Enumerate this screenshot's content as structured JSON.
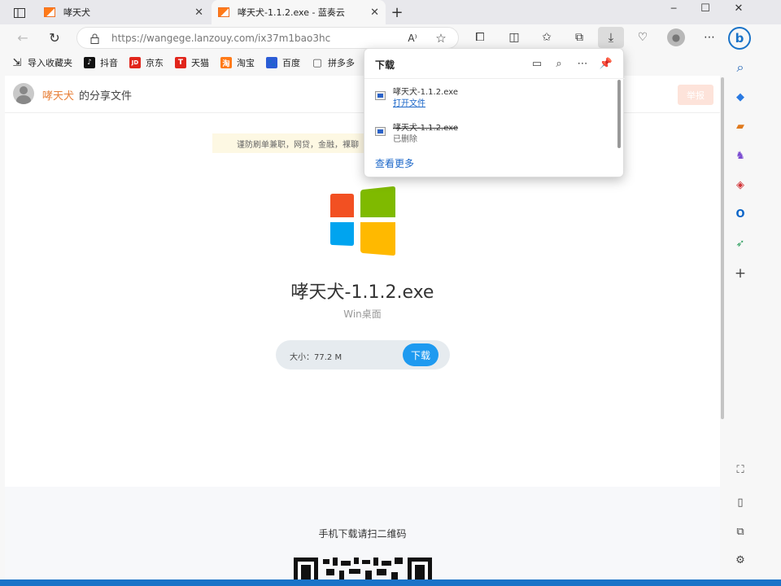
{
  "tabs": [
    {
      "title": "哮天犬",
      "active": false
    },
    {
      "title": "哮天犬-1.1.2.exe - 蓝奏云",
      "active": true
    }
  ],
  "window_controls": {
    "minimize": "─",
    "maximize": "☐",
    "close": "✕",
    "new_tab": "+"
  },
  "address_bar": {
    "url": "https://wangege.lanzouy.com/ix37m1bao3hc",
    "read_aloud": "A⁾"
  },
  "bookmarks": [
    {
      "label": "导入收藏夹",
      "icon": "import-icon",
      "color": "#555555",
      "glyph": "⇲"
    },
    {
      "label": "抖音",
      "icon": "douyin-icon",
      "color": "#111111",
      "glyph": "♪"
    },
    {
      "label": "京东",
      "icon": "jd-icon",
      "color": "#e1251b",
      "glyph": "JD"
    },
    {
      "label": "天猫",
      "icon": "tmall-icon",
      "color": "#e1251b",
      "glyph": "T"
    },
    {
      "label": "淘宝",
      "icon": "taobao-icon",
      "color": "#ff7a18",
      "glyph": "淘"
    },
    {
      "label": "百度",
      "icon": "baidu-icon",
      "color": "#2b5cd6",
      "glyph": "🐾"
    },
    {
      "label": "拼多多",
      "icon": "document-icon",
      "color": "#777777",
      "glyph": "▢"
    }
  ],
  "page": {
    "owner_name": "哮天犬",
    "owner_suffix": "的分享文件",
    "report_label": "举报",
    "notice": "谨防刷单兼职，网贷，金融，裸聊",
    "file_name": "哮天犬-1.1.2.exe",
    "file_category": "Win桌面",
    "size_label": "大小：77.2 M",
    "download_label": "下载",
    "qr_hint": "手机下载请扫二维码",
    "logo_colors": [
      "#f25022",
      "#7fba00",
      "#00a4ef",
      "#ffb900"
    ]
  },
  "downloads_panel": {
    "title": "下载",
    "items": [
      {
        "name": "哮天犬-1.1.2.exe",
        "action": "打开文件",
        "deleted": false
      },
      {
        "name": "哮天犬-1.1.2.exe",
        "status": "已删除",
        "deleted": true
      }
    ],
    "see_more": "查看更多"
  },
  "sidebar": [
    {
      "name": "bing-icon",
      "glyph": "b",
      "color": "#1a73c8"
    },
    {
      "name": "search-icon",
      "glyph": "⌕",
      "color": "#1a5fb4"
    },
    {
      "name": "shopping-tag-icon",
      "glyph": "🏷",
      "color": "#2a7ae2"
    },
    {
      "name": "tools-icon",
      "glyph": "🧰",
      "color": "#e07a1e"
    },
    {
      "name": "games-icon",
      "glyph": "♞",
      "color": "#7a4bd1"
    },
    {
      "name": "office-icon",
      "glyph": "◈",
      "color": "#d13438"
    },
    {
      "name": "outlook-icon",
      "glyph": "O",
      "color": "#0a64c8"
    },
    {
      "name": "send-icon",
      "glyph": "➶",
      "color": "#2a9d5c"
    },
    {
      "name": "add-icon",
      "glyph": "+",
      "color": "#444444"
    }
  ],
  "sidebar_bottom": [
    {
      "name": "screenshot-icon",
      "glyph": "⛶"
    },
    {
      "name": "split-view-icon",
      "glyph": "▯"
    },
    {
      "name": "open-external-icon",
      "glyph": "⧉"
    },
    {
      "name": "settings-icon",
      "glyph": "⚙"
    }
  ]
}
